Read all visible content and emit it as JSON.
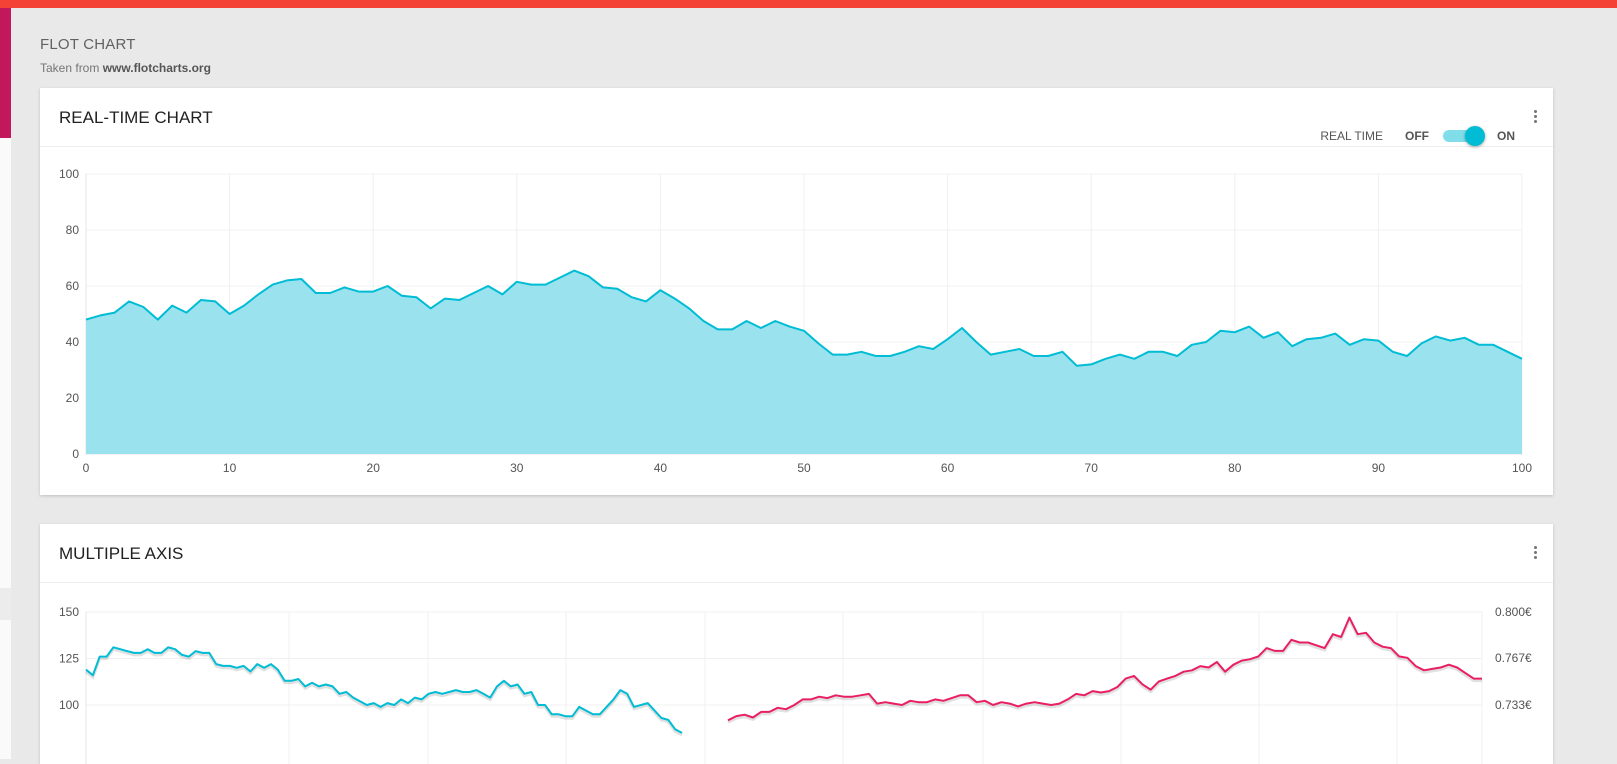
{
  "page": {
    "title": "FLOT CHART",
    "subtitle_prefix": "Taken from ",
    "subtitle_link": "www.flotcharts.org"
  },
  "realtime_card": {
    "title": "REAL-TIME CHART",
    "toggle": {
      "label": "REAL TIME",
      "off_label": "OFF",
      "on_label": "ON",
      "state": "on"
    },
    "more_icon": "more-vert-icon"
  },
  "multiaxis_card": {
    "title": "MULTIPLE AXIS",
    "more_icon": "more-vert-icon"
  },
  "colors": {
    "accent_top": "#f44336",
    "accent_left": "#c2185b",
    "series_cyan": "#00bcd4",
    "area_cyan": "#9ae3ee",
    "series_pink": "#e91e63"
  },
  "chart_data": [
    {
      "type": "area",
      "x": [
        0,
        1,
        2,
        3,
        4,
        5,
        6,
        7,
        8,
        9,
        10,
        11,
        12,
        13,
        14,
        15,
        16,
        17,
        18,
        19,
        20,
        21,
        22,
        23,
        24,
        25,
        26,
        27,
        28,
        29,
        30,
        31,
        32,
        33,
        34,
        35,
        36,
        37,
        38,
        39,
        40,
        41,
        42,
        43,
        44,
        45,
        46,
        47,
        48,
        49,
        50,
        51,
        52,
        53,
        54,
        55,
        56,
        57,
        58,
        59,
        60,
        61,
        62,
        63,
        64,
        65,
        66,
        67,
        68,
        69,
        70,
        71,
        72,
        73,
        74,
        75,
        76,
        77,
        78,
        79,
        80,
        81,
        82,
        83,
        84,
        85,
        86,
        87,
        88,
        89,
        90,
        91,
        92,
        93,
        94,
        95,
        96,
        97,
        98,
        99,
        100
      ],
      "y": [
        48,
        49.5,
        50.5,
        54.5,
        52.5,
        48,
        53,
        50.5,
        55,
        54.5,
        50,
        53,
        57,
        60.5,
        62,
        62.5,
        57.5,
        57.5,
        59.5,
        58,
        58,
        60,
        56.5,
        56,
        52,
        55.5,
        55,
        57.5,
        60,
        57,
        61.5,
        60.5,
        60.5,
        63,
        65.5,
        63.5,
        59.5,
        59,
        56,
        54.5,
        58.5,
        55.5,
        52,
        47.5,
        44.5,
        44.5,
        47.5,
        45,
        47.5,
        45.5,
        44,
        39.5,
        35.5,
        35.5,
        36.5,
        35,
        35,
        36.5,
        38.5,
        37.5,
        41,
        45,
        40,
        35.5,
        36.5,
        37.5,
        35,
        35,
        36.5,
        31.5,
        32,
        34,
        35.5,
        34,
        36.5,
        36.5,
        35,
        39,
        40,
        44,
        43.5,
        45.5,
        41.5,
        43.5,
        38.5,
        41,
        41.5,
        43,
        39,
        41,
        40.5,
        36.5,
        35,
        39.5,
        42,
        40.5,
        41.5,
        39,
        39,
        36.5,
        34
      ],
      "xlim": [
        0,
        100
      ],
      "ylim": [
        0,
        100
      ],
      "xticks": [
        0,
        10,
        20,
        30,
        40,
        50,
        60,
        70,
        80,
        90,
        100
      ],
      "yticks": [
        0,
        20,
        40,
        60,
        80,
        100
      ],
      "grid": true
    },
    {
      "type": "line",
      "series": [
        {
          "axis": "left",
          "color": "#00bcd4",
          "y": [
            119,
            116,
            126,
            126,
            131,
            130,
            129,
            128,
            128,
            130,
            128,
            128,
            131,
            130,
            127,
            126,
            129,
            128,
            128,
            122,
            121,
            121,
            120,
            121,
            118,
            122,
            120,
            122,
            119,
            113,
            113,
            114,
            110,
            112,
            110,
            111,
            110,
            106,
            107,
            104,
            102,
            100,
            101,
            99,
            101,
            100,
            103,
            101,
            104,
            103,
            106,
            107,
            106,
            107,
            108,
            107,
            107,
            108,
            106,
            104,
            110,
            113,
            110,
            111,
            106,
            107,
            100,
            100,
            95,
            95,
            94,
            94,
            99,
            97,
            95,
            95,
            99,
            103,
            108,
            106,
            99,
            100,
            101,
            97,
            93,
            92,
            87,
            85
          ]
        },
        {
          "axis": "right",
          "color": "#e91e63",
          "y": [
            0.722,
            0.725,
            0.726,
            0.724,
            0.728,
            0.728,
            0.731,
            0.73,
            0.733,
            0.737,
            0.737,
            0.739,
            0.738,
            0.74,
            0.739,
            0.739,
            0.74,
            0.741,
            0.734,
            0.735,
            0.734,
            0.733,
            0.736,
            0.735,
            0.735,
            0.737,
            0.736,
            0.738,
            0.74,
            0.74,
            0.735,
            0.736,
            0.733,
            0.735,
            0.734,
            0.732,
            0.734,
            0.735,
            0.734,
            0.733,
            0.734,
            0.737,
            0.741,
            0.74,
            0.743,
            0.742,
            0.743,
            0.746,
            0.752,
            0.754,
            0.748,
            0.744,
            0.75,
            0.752,
            0.754,
            0.757,
            0.758,
            0.761,
            0.76,
            0.764,
            0.757,
            0.762,
            0.765,
            0.766,
            0.768,
            0.774,
            0.772,
            0.772,
            0.78,
            0.778,
            0.778,
            0.776,
            0.774,
            0.784,
            0.782,
            0.796,
            0.784,
            0.785,
            0.778,
            0.775,
            0.774,
            0.768,
            0.767,
            0.761,
            0.758,
            0.759,
            0.76,
            0.762,
            0.76,
            0.756,
            0.752,
            0.752
          ]
        }
      ],
      "left_ticks": [
        150,
        125,
        100
      ],
      "right_ticks": [
        "0.800€",
        "0.767€",
        "0.733€"
      ],
      "grid": true
    }
  ]
}
